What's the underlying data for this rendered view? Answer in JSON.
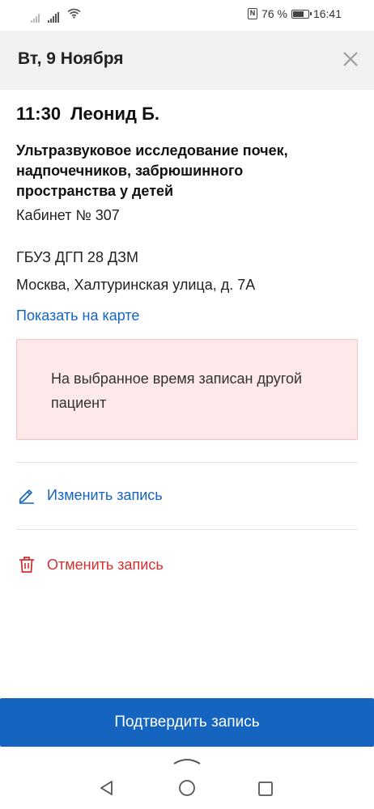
{
  "status_bar": {
    "battery_text": "76 %",
    "battery_level": 0.76,
    "time": "16:41",
    "nfc_label": "N"
  },
  "header": {
    "title": "Вт, 9 Ноября",
    "close_icon": "close-icon"
  },
  "appointment": {
    "time": "11:30",
    "doctor": "Леонид Б.",
    "service": "Ультразвуковое исследование почек, надпочечников, забрюшинного пространства у детей",
    "cabinet": "Кабинет № 307",
    "organization": "ГБУЗ ДГП 28 ДЗМ",
    "address": "Москва, Халтуринская улица, д. 7А",
    "map_link": "Показать на карте"
  },
  "alert": {
    "text": "На выбранное время записан другой пациент",
    "bg_color": "#fde9e9"
  },
  "actions": {
    "edit": {
      "label": "Изменить запись",
      "icon": "pencil-icon",
      "color": "#1565c0"
    },
    "cancel": {
      "label": "Отменить запись",
      "icon": "trash-icon",
      "color": "#d32f2f"
    }
  },
  "confirm_button": {
    "label": "Подтвердить запись",
    "color": "#1565c0"
  },
  "navigation": {
    "icons": [
      "back-icon",
      "home-icon",
      "recent-apps-icon"
    ]
  }
}
